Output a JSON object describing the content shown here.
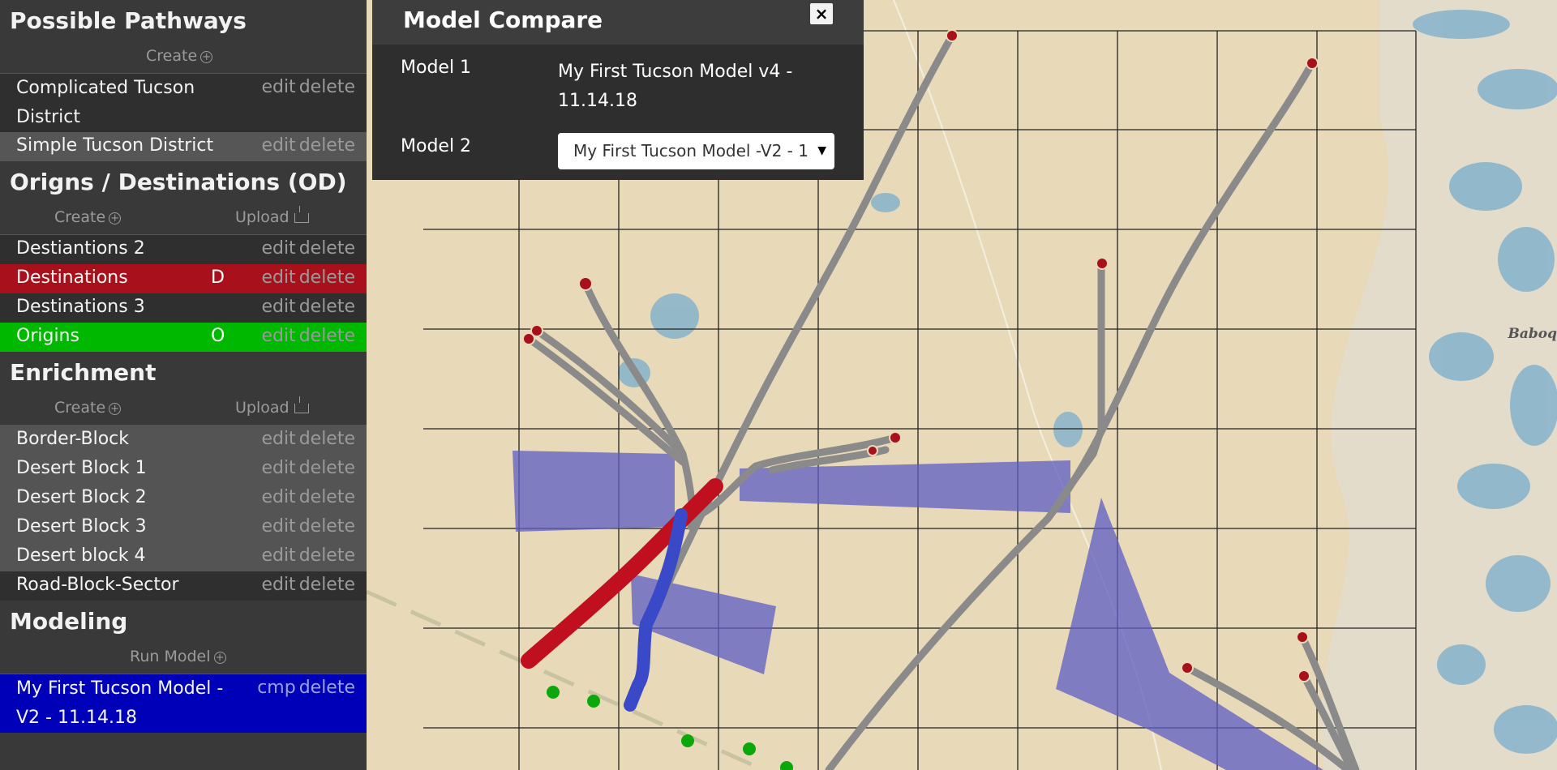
{
  "sidebar": {
    "pathways": {
      "title": "Possible Pathways",
      "create_label": "Create",
      "items": [
        {
          "label": "Complicated Tucson District",
          "edit": "edit",
          "delete": "delete"
        },
        {
          "label": "Simple Tucson District",
          "edit": "edit",
          "delete": "delete"
        }
      ]
    },
    "od": {
      "title": "Origns / Destinations (OD)",
      "create_label": "Create",
      "upload_label": "Upload",
      "items": [
        {
          "label": "Destiantions 2",
          "code": "",
          "edit": "edit",
          "delete": "delete"
        },
        {
          "label": "Destinations",
          "code": "D",
          "edit": "edit",
          "delete": "delete",
          "color": "#a8111b"
        },
        {
          "label": "Destinations 3",
          "code": "",
          "edit": "edit",
          "delete": "delete"
        },
        {
          "label": "Origins",
          "code": "O",
          "edit": "edit",
          "delete": "delete",
          "color": "#00b800"
        }
      ]
    },
    "enrichment": {
      "title": "Enrichment",
      "create_label": "Create",
      "upload_label": "Upload",
      "items": [
        {
          "label": "Border-Block",
          "edit": "edit",
          "delete": "delete"
        },
        {
          "label": "Desert Block 1",
          "edit": "edit",
          "delete": "delete"
        },
        {
          "label": "Desert Block 2",
          "edit": "edit",
          "delete": "delete"
        },
        {
          "label": "Desert Block 3",
          "edit": "edit",
          "delete": "delete"
        },
        {
          "label": "Desert block 4",
          "edit": "edit",
          "delete": "delete"
        },
        {
          "label": "Road-Block-Sector",
          "edit": "edit",
          "delete": "delete"
        }
      ]
    },
    "modeling": {
      "title": "Modeling",
      "run_label": "Run Model",
      "items": [
        {
          "label": "My First Tucson Model -V2 - 11.14.18",
          "cmp": "cmp",
          "delete": "delete",
          "color": "#0000b8"
        }
      ]
    }
  },
  "compare": {
    "title": "Model Compare",
    "close_icon": "×",
    "model1_label": "Model 1",
    "model1_value": "My First Tucson Model v4 - 11.14.18",
    "model2_label": "Model 2",
    "model2_selected": "My First Tucson Model -V2 - 1"
  },
  "map": {
    "place_label": "Baboq",
    "colors": {
      "route": "#8a8a8a",
      "destination_path": "#c0101f",
      "origin_path": "#3a49c8",
      "block": "#5d5cc4",
      "origin_dot": "#0aa80a"
    }
  }
}
